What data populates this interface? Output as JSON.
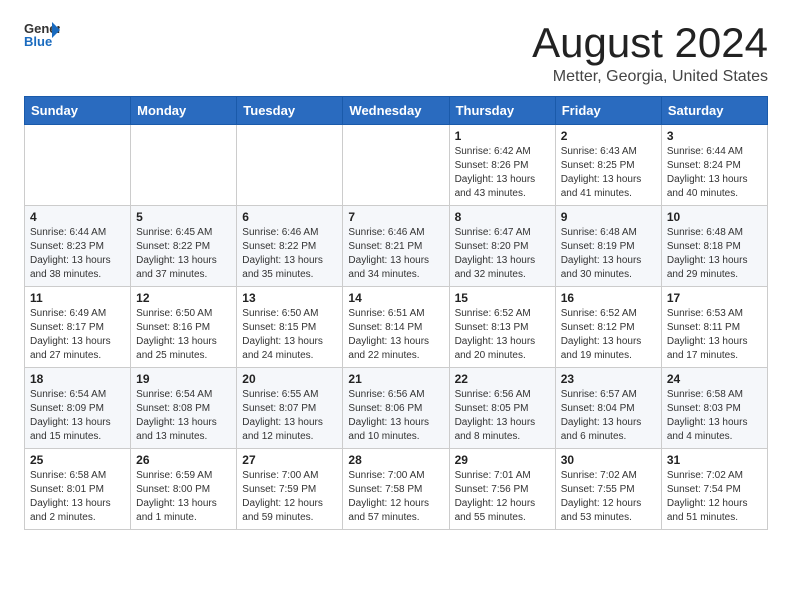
{
  "header": {
    "logo_general": "General",
    "logo_blue": "Blue",
    "month_year": "August 2024",
    "location": "Metter, Georgia, United States"
  },
  "calendar": {
    "days_of_week": [
      "Sunday",
      "Monday",
      "Tuesday",
      "Wednesday",
      "Thursday",
      "Friday",
      "Saturday"
    ],
    "weeks": [
      [
        {
          "day": "",
          "info": ""
        },
        {
          "day": "",
          "info": ""
        },
        {
          "day": "",
          "info": ""
        },
        {
          "day": "",
          "info": ""
        },
        {
          "day": "1",
          "info": "Sunrise: 6:42 AM\nSunset: 8:26 PM\nDaylight: 13 hours\nand 43 minutes."
        },
        {
          "day": "2",
          "info": "Sunrise: 6:43 AM\nSunset: 8:25 PM\nDaylight: 13 hours\nand 41 minutes."
        },
        {
          "day": "3",
          "info": "Sunrise: 6:44 AM\nSunset: 8:24 PM\nDaylight: 13 hours\nand 40 minutes."
        }
      ],
      [
        {
          "day": "4",
          "info": "Sunrise: 6:44 AM\nSunset: 8:23 PM\nDaylight: 13 hours\nand 38 minutes."
        },
        {
          "day": "5",
          "info": "Sunrise: 6:45 AM\nSunset: 8:22 PM\nDaylight: 13 hours\nand 37 minutes."
        },
        {
          "day": "6",
          "info": "Sunrise: 6:46 AM\nSunset: 8:22 PM\nDaylight: 13 hours\nand 35 minutes."
        },
        {
          "day": "7",
          "info": "Sunrise: 6:46 AM\nSunset: 8:21 PM\nDaylight: 13 hours\nand 34 minutes."
        },
        {
          "day": "8",
          "info": "Sunrise: 6:47 AM\nSunset: 8:20 PM\nDaylight: 13 hours\nand 32 minutes."
        },
        {
          "day": "9",
          "info": "Sunrise: 6:48 AM\nSunset: 8:19 PM\nDaylight: 13 hours\nand 30 minutes."
        },
        {
          "day": "10",
          "info": "Sunrise: 6:48 AM\nSunset: 8:18 PM\nDaylight: 13 hours\nand 29 minutes."
        }
      ],
      [
        {
          "day": "11",
          "info": "Sunrise: 6:49 AM\nSunset: 8:17 PM\nDaylight: 13 hours\nand 27 minutes."
        },
        {
          "day": "12",
          "info": "Sunrise: 6:50 AM\nSunset: 8:16 PM\nDaylight: 13 hours\nand 25 minutes."
        },
        {
          "day": "13",
          "info": "Sunrise: 6:50 AM\nSunset: 8:15 PM\nDaylight: 13 hours\nand 24 minutes."
        },
        {
          "day": "14",
          "info": "Sunrise: 6:51 AM\nSunset: 8:14 PM\nDaylight: 13 hours\nand 22 minutes."
        },
        {
          "day": "15",
          "info": "Sunrise: 6:52 AM\nSunset: 8:13 PM\nDaylight: 13 hours\nand 20 minutes."
        },
        {
          "day": "16",
          "info": "Sunrise: 6:52 AM\nSunset: 8:12 PM\nDaylight: 13 hours\nand 19 minutes."
        },
        {
          "day": "17",
          "info": "Sunrise: 6:53 AM\nSunset: 8:11 PM\nDaylight: 13 hours\nand 17 minutes."
        }
      ],
      [
        {
          "day": "18",
          "info": "Sunrise: 6:54 AM\nSunset: 8:09 PM\nDaylight: 13 hours\nand 15 minutes."
        },
        {
          "day": "19",
          "info": "Sunrise: 6:54 AM\nSunset: 8:08 PM\nDaylight: 13 hours\nand 13 minutes."
        },
        {
          "day": "20",
          "info": "Sunrise: 6:55 AM\nSunset: 8:07 PM\nDaylight: 13 hours\nand 12 minutes."
        },
        {
          "day": "21",
          "info": "Sunrise: 6:56 AM\nSunset: 8:06 PM\nDaylight: 13 hours\nand 10 minutes."
        },
        {
          "day": "22",
          "info": "Sunrise: 6:56 AM\nSunset: 8:05 PM\nDaylight: 13 hours\nand 8 minutes."
        },
        {
          "day": "23",
          "info": "Sunrise: 6:57 AM\nSunset: 8:04 PM\nDaylight: 13 hours\nand 6 minutes."
        },
        {
          "day": "24",
          "info": "Sunrise: 6:58 AM\nSunset: 8:03 PM\nDaylight: 13 hours\nand 4 minutes."
        }
      ],
      [
        {
          "day": "25",
          "info": "Sunrise: 6:58 AM\nSunset: 8:01 PM\nDaylight: 13 hours\nand 2 minutes."
        },
        {
          "day": "26",
          "info": "Sunrise: 6:59 AM\nSunset: 8:00 PM\nDaylight: 13 hours\nand 1 minute."
        },
        {
          "day": "27",
          "info": "Sunrise: 7:00 AM\nSunset: 7:59 PM\nDaylight: 12 hours\nand 59 minutes."
        },
        {
          "day": "28",
          "info": "Sunrise: 7:00 AM\nSunset: 7:58 PM\nDaylight: 12 hours\nand 57 minutes."
        },
        {
          "day": "29",
          "info": "Sunrise: 7:01 AM\nSunset: 7:56 PM\nDaylight: 12 hours\nand 55 minutes."
        },
        {
          "day": "30",
          "info": "Sunrise: 7:02 AM\nSunset: 7:55 PM\nDaylight: 12 hours\nand 53 minutes."
        },
        {
          "day": "31",
          "info": "Sunrise: 7:02 AM\nSunset: 7:54 PM\nDaylight: 12 hours\nand 51 minutes."
        }
      ]
    ]
  }
}
